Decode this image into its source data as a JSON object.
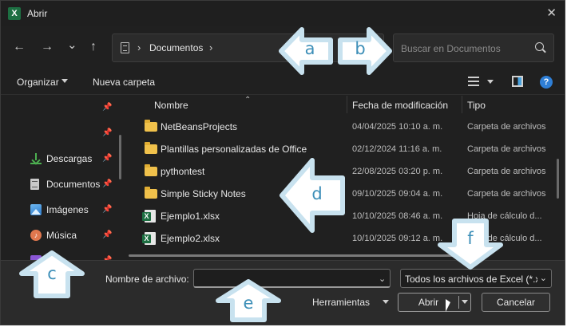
{
  "window": {
    "title": "Abrir",
    "app_icon": "X",
    "close_label": "✕"
  },
  "nav": {
    "back": "←",
    "forward": "→",
    "recent": "⌄",
    "up": "↑"
  },
  "address_bar": {
    "chevron_left": "›",
    "path": "Documentos",
    "chevron_right": "›"
  },
  "search": {
    "placeholder": "Buscar en Documentos"
  },
  "toolbar": {
    "organize_label": "Organizar",
    "new_folder_label": "Nueva carpeta",
    "help_label": "?"
  },
  "sidebar": {
    "items": [
      {
        "label": "",
        "icon": "pin-icon",
        "pinned": true
      },
      {
        "label": "",
        "icon": "pin-icon",
        "pinned": true
      },
      {
        "label": "Descargas",
        "icon": "download-icon",
        "pinned": true
      },
      {
        "label": "Documentos",
        "icon": "document-icon",
        "pinned": true
      },
      {
        "label": "Imágenes",
        "icon": "picture-icon",
        "pinned": true
      },
      {
        "label": "Música",
        "icon": "music-icon",
        "pinned": true
      },
      {
        "label": "",
        "icon": "video-icon",
        "pinned": true
      }
    ]
  },
  "file_list": {
    "columns": {
      "name": "Nombre",
      "modified": "Fecha de modificación",
      "type": "Tipo"
    },
    "sort_indicator": "⌃",
    "rows": [
      {
        "name": "NetBeansProjects",
        "modified": "04/04/2025 10:10 a. m.",
        "type": "Carpeta de archivos",
        "icon": "folder-icon"
      },
      {
        "name": "Plantillas personalizadas de Office",
        "modified": "02/12/2024 11:16 a. m.",
        "type": "Carpeta de archivos",
        "icon": "folder-icon"
      },
      {
        "name": "pythontest",
        "modified": "22/08/2025 03:20 p. m.",
        "type": "Carpeta de archivos",
        "icon": "folder-icon"
      },
      {
        "name": "Simple Sticky Notes",
        "modified": "09/10/2025 09:04 a. m.",
        "type": "Carpeta de archivos",
        "icon": "folder-icon"
      },
      {
        "name": "Ejemplo1.xlsx",
        "modified": "10/10/2025 08:46 a. m.",
        "type": "Hoja de cálculo d...",
        "icon": "excel-file-icon"
      },
      {
        "name": "Ejemplo2.xlsx",
        "modified": "10/10/2025 09:12 a. m.",
        "type": "Hoja de cálculo d...",
        "icon": "excel-file-icon"
      }
    ]
  },
  "footer": {
    "filename_label": "Nombre de archivo:",
    "filename_value": "",
    "filetype_value": "Todos los archivos de Excel (*.xl",
    "dropdown_chevron": "⌄",
    "tools_label": "Herramientas",
    "open_label": "Abrir",
    "cancel_label": "Cancelar"
  },
  "annotations": {
    "a": {
      "label": "a",
      "direction": "left"
    },
    "b": {
      "label": "b",
      "direction": "right"
    },
    "c": {
      "label": "c",
      "direction": "up"
    },
    "d": {
      "label": "d",
      "direction": "left"
    },
    "e": {
      "label": "e",
      "direction": "up"
    },
    "f": {
      "label": "f",
      "direction": "down"
    }
  },
  "colors": {
    "dialog_bg": "#202020",
    "footer_bg": "#2b2b2b",
    "folder": "#f0c14b",
    "excel_green": "#1d6f42",
    "annotation_stroke": "#c8e2ef",
    "annotation_letter": "#3d8fb8",
    "help_blue": "#2f7fd6"
  }
}
